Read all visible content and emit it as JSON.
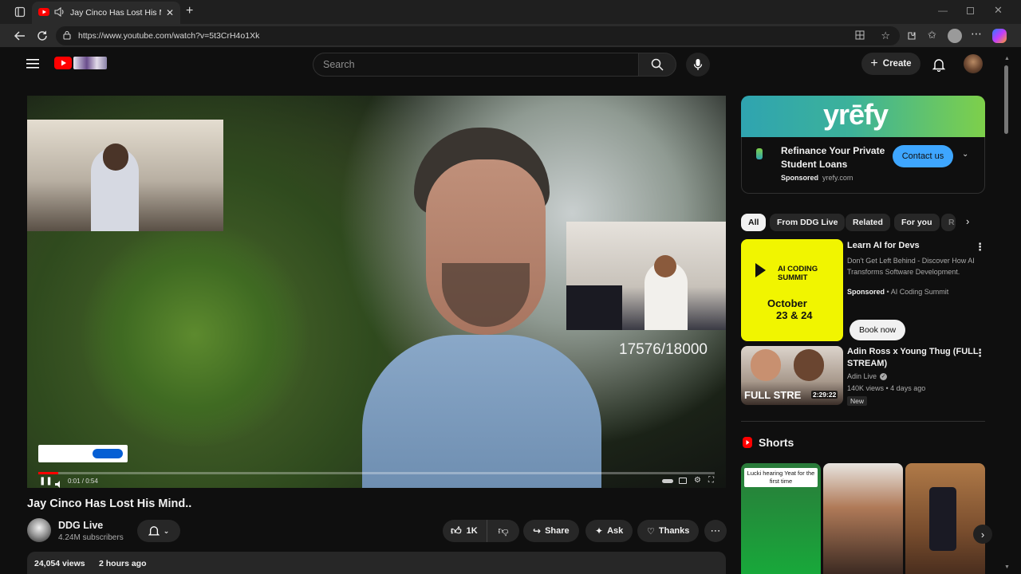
{
  "browser": {
    "tab_title": "Jay Cinco Has Lost His Mind",
    "url": "https://www.youtube.com/watch?v=5t3CrH4o1Xk",
    "new_tab_symbol": "+"
  },
  "youtube": {
    "search_placeholder": "Search",
    "create_label": "Create"
  },
  "player": {
    "overlay_count": "17576/18000",
    "time": "0:01 / 0:54"
  },
  "video": {
    "title": "Jay Cinco Has Lost His Mind..",
    "channel": "DDG Live",
    "subscribers": "4.24M subscribers",
    "like_count": "1K",
    "share_label": "Share",
    "ask_label": "Ask",
    "thanks_label": "Thanks",
    "views": "24,054 views",
    "age": "2 hours ago"
  },
  "ad": {
    "brand": "yrēfy",
    "headline_line1": "Refinance Your Private",
    "headline_line2": "Student Loans",
    "sponsored": "Sponsored",
    "domain": "yrefy.com",
    "cta": "Contact us"
  },
  "chips": [
    "All",
    "From DDG Live",
    "Related",
    "For you",
    "R"
  ],
  "recommendations": [
    {
      "title": "Learn AI for Devs",
      "desc": "Don't Get Left Behind - Discover How AI Transforms Software Development.",
      "sponsored": "Sponsored",
      "source": "AI Coding Summit",
      "cta": "Book now",
      "thumb_line1": "AI CODING",
      "thumb_line2": "SUMMIT",
      "thumb_date1": "October",
      "thumb_date2": "23 & 24"
    },
    {
      "title_line1": "Adin Ross x Young Thug (FULL",
      "title_line2": "STREAM)",
      "channel": "Adin Live",
      "meta": "140K views • 4 days ago",
      "badge": "New",
      "thumb_text": "FULL STRE",
      "duration": "2:29:22"
    }
  ],
  "shorts": {
    "heading": "Shorts",
    "first_caption": "Lucki hearing Yeat for the first time"
  },
  "colors": {
    "accent_red": "#ff0000",
    "contact_blue": "#3ea6ff",
    "ad_yellow": "#f1f500",
    "background": "#0f0f0f"
  }
}
